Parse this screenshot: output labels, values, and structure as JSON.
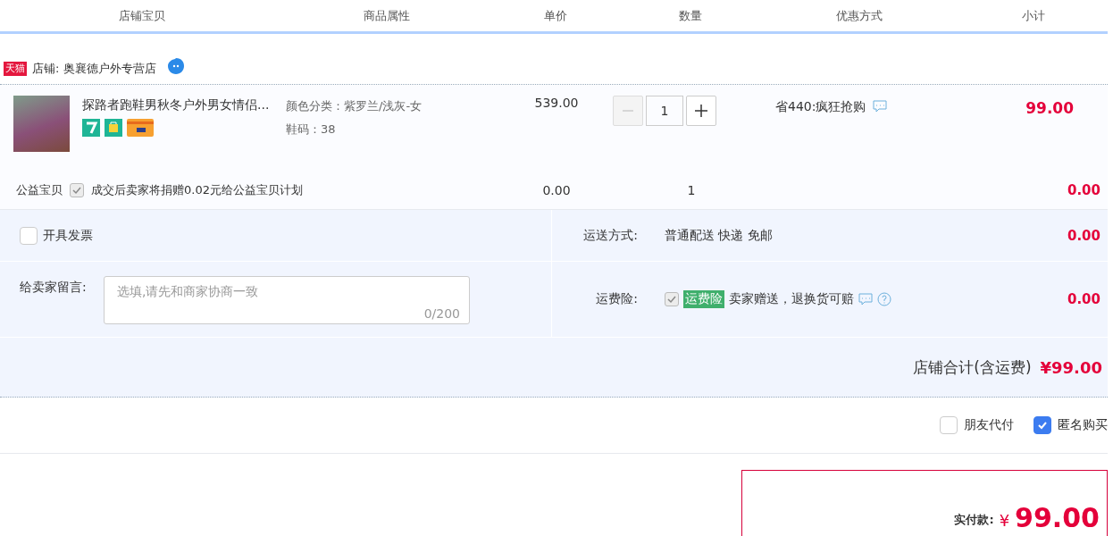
{
  "columns": [
    "店铺宝贝",
    "商品属性",
    "单价",
    "数量",
    "优惠方式",
    "小计"
  ],
  "shop": {
    "badge": "天猫",
    "label": "店铺: 奥襄德户外专营店"
  },
  "item": {
    "title": "探路者跑鞋男秋冬户外男女情侣...",
    "attributes": [
      "颜色分类：紫罗兰/浅灰-女",
      "鞋码：38"
    ],
    "price": "539.00",
    "quantity": "1",
    "minus_disabled": true,
    "promo": "省440:疯狂抢购",
    "subtotal": "99.00"
  },
  "charity": {
    "label": "公益宝贝",
    "checked": true,
    "text": "成交后卖家将捐赠0.02元给公益宝贝计划",
    "price": "0.00",
    "quantity": "1",
    "subtotal": "0.00"
  },
  "invoice": {
    "label": "开具发票",
    "checked": false
  },
  "shipping": {
    "label": "运送方式:",
    "value": "普通配送 快递 免邮",
    "amount": "0.00"
  },
  "message": {
    "label": "给卖家留言:",
    "placeholder": "选填,请先和商家协商一致",
    "counter": "0/200"
  },
  "insurance": {
    "label": "运费险:",
    "checked": true,
    "tag": "运费险",
    "text": "卖家赠送，退换货可赔",
    "amount": "0.00"
  },
  "total": {
    "label": "店铺合计(含运费)",
    "amount": "¥99.00"
  },
  "options": [
    {
      "label": "朋友代付",
      "checked": false
    },
    {
      "label": "匿名购买",
      "checked": true
    }
  ],
  "payment": {
    "label": "实付款:",
    "currency": "¥",
    "amount": "99.00"
  }
}
